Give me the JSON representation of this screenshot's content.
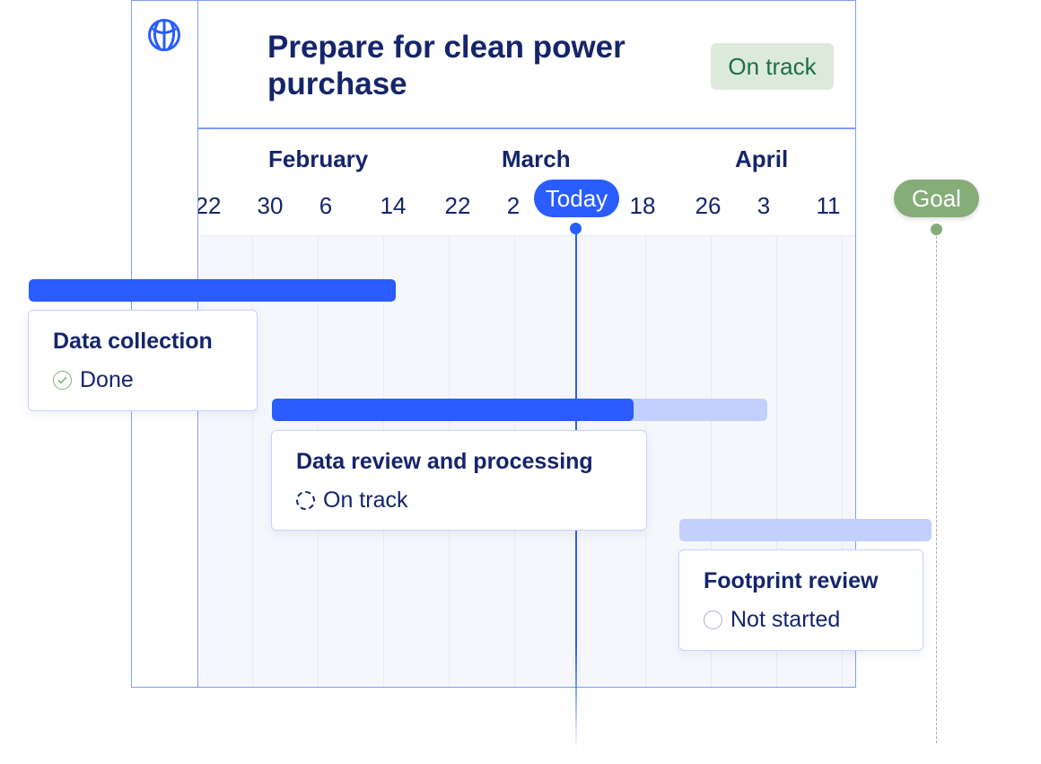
{
  "header": {
    "title": "Prepare for clean power purchase",
    "status": "On track",
    "status_color": "#dcebd9",
    "logo": "globe-icon"
  },
  "timeline": {
    "months": [
      "February",
      "March",
      "April"
    ],
    "ticks": [
      "22",
      "30",
      "6",
      "14",
      "22",
      "2",
      "18",
      "26",
      "3",
      "11"
    ],
    "today_label": "Today",
    "goal_label": "Goal"
  },
  "tasks": [
    {
      "name": "Data collection",
      "status": "Done",
      "status_icon": "check-circle-icon",
      "progress": 1.0
    },
    {
      "name": "Data review and processing",
      "status": "On track",
      "status_icon": "dashed-circle-icon",
      "progress": 0.73
    },
    {
      "name": "Footprint review",
      "status": "Not started",
      "status_icon": "empty-circle-icon",
      "progress": 0
    }
  ],
  "colors": {
    "accent": "#2a5cff",
    "goal": "#86ad78",
    "bar_remaining": "#c3d0fb"
  }
}
